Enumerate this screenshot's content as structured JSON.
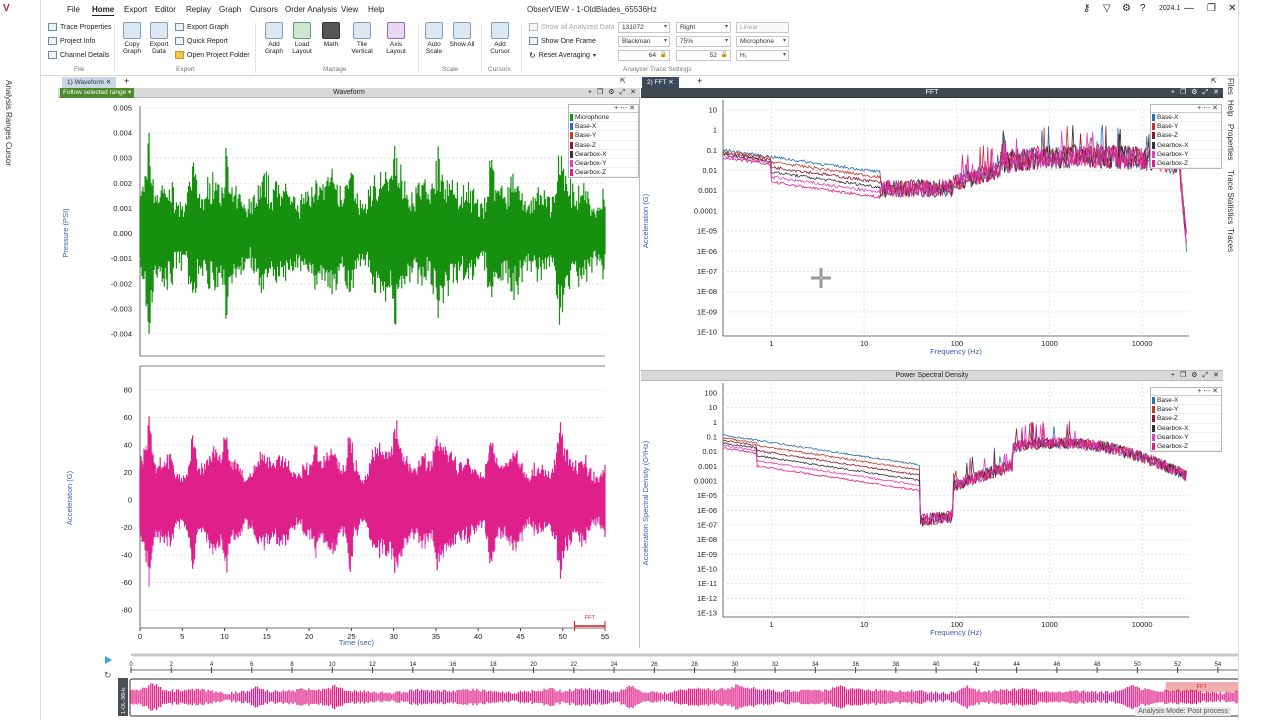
{
  "window": {
    "title": "ObserVIEW - 1-OldBlades_65536Hz",
    "version": "2024.1"
  },
  "menu": [
    "File",
    "Home",
    "Export",
    "Editor",
    "Replay",
    "Graph",
    "Cursors",
    "Order Analysis",
    "View",
    "Help"
  ],
  "menu_active": "Home",
  "ribbon": {
    "file": {
      "items": [
        "Trace Properties",
        "Project Info",
        "Channel Details"
      ],
      "label": "File"
    },
    "export": {
      "big": [
        "Copy Graph",
        "Export Data"
      ],
      "small": [
        "Export Graph",
        "Quick Report",
        "Open Project Folder"
      ],
      "label": "Export"
    },
    "manage": {
      "big": [
        "Add Graph",
        "Load Layout",
        "Math",
        "Tile Vertical",
        "Axis Layout"
      ],
      "label": "Manage"
    },
    "scale": {
      "big": [
        "Auto Scale",
        "Show All"
      ],
      "label": "Scale"
    },
    "cursors": {
      "big": [
        "Add Cursor"
      ],
      "label": "Cursors"
    },
    "analyzer": {
      "label": "Analyzer Trace Settings",
      "checks": [
        "Show all Analyzed Data",
        "Show One Frame",
        "Reset Averaging"
      ],
      "fields": {
        "frame_size": "131072",
        "window": "Blackman",
        "overlap": "75%",
        "averages": "64",
        "frames": "52",
        "align": "Right",
        "reference": "Microphone",
        "scale": "Linear",
        "estimator": "H₁"
      }
    }
  },
  "left_tabs": [
    "Analysis Ranges",
    "Cursor"
  ],
  "right_tabs": [
    "Files",
    "Help",
    "Properties",
    "Trace Statistics",
    "Traces"
  ],
  "doc_tabs": {
    "left": "1) Waveform",
    "right": "2) FFT"
  },
  "waveform": {
    "header": "Waveform",
    "follow_label": "Follow selected range",
    "top_ylabel": "Pressure (PSI)",
    "top_yticks": [
      "0.005",
      "0.004",
      "0.003",
      "0.002",
      "0.001",
      "0.000",
      "-0.001",
      "-0.002",
      "-0.003",
      "-0.004"
    ],
    "bottom_ylabel": "Acceleration (G)",
    "bottom_yticks": [
      "80",
      "60",
      "40",
      "20",
      "0",
      "-20",
      "-40",
      "-60",
      "-80"
    ],
    "xlabel": "Time (sec)",
    "xticks": [
      "0",
      "5",
      "10",
      "15",
      "20",
      "25",
      "30",
      "35",
      "40",
      "45",
      "50",
      "55"
    ],
    "fft_marker": "FFT",
    "colors": {
      "mic": "#16900e",
      "accel": "#e0208a"
    }
  },
  "fft": {
    "header": "FFT",
    "ylabel": "Acceleration (G)",
    "yticks": [
      "10",
      "1",
      "0.1",
      "0.01",
      "0.001",
      "0.0001",
      "1E-05",
      "1E-06",
      "1E-07",
      "1E-08",
      "1E-09",
      "1E-10"
    ],
    "xlabel": "Frequency (Hz)",
    "xticks": [
      "1",
      "10",
      "100",
      "1000",
      "10000"
    ]
  },
  "psd": {
    "header": "Power Spectral Density",
    "ylabel": "Acceleration Spectral Density (G²/Hz)",
    "yticks": [
      "100",
      "10",
      "1",
      "0.1",
      "0.01",
      "0.001",
      "0.0001",
      "1E-05",
      "1E-06",
      "1E-07",
      "1E-08",
      "1E-09",
      "1E-10",
      "1E-11",
      "1E-12",
      "1E-13"
    ],
    "xlabel": "Frequency (Hz)",
    "xticks": [
      "1",
      "10",
      "100",
      "1000",
      "10000"
    ]
  },
  "legend_waveform": [
    {
      "name": "Microphone",
      "color": "#16900e"
    },
    {
      "name": "Base-X",
      "color": "#2a6fb0"
    },
    {
      "name": "Base-Y",
      "color": "#c0392b"
    },
    {
      "name": "Base-Z",
      "color": "#8e1a2e"
    },
    {
      "name": "Gearbox-X",
      "color": "#333333"
    },
    {
      "name": "Gearbox-Y",
      "color": "#e040c0"
    },
    {
      "name": "Gearbox-Z",
      "color": "#e0208a"
    }
  ],
  "legend_spectra": [
    {
      "name": "Base-X",
      "color": "#2a6fb0"
    },
    {
      "name": "Base-Y",
      "color": "#c0392b"
    },
    {
      "name": "Base-Z",
      "color": "#8e1a2e"
    },
    {
      "name": "Gearbox-X",
      "color": "#333333"
    },
    {
      "name": "Gearbox-Y",
      "color": "#e040c0"
    },
    {
      "name": "Gearbox-Z",
      "color": "#e0208a"
    }
  ],
  "timeline": {
    "ticks": [
      "0",
      "2",
      "4",
      "6",
      "8",
      "10",
      "12",
      "14",
      "16",
      "18",
      "20",
      "22",
      "24",
      "26",
      "28",
      "30",
      "32",
      "34",
      "36",
      "38",
      "40",
      "42",
      "44",
      "46",
      "48",
      "50",
      "52",
      "54"
    ],
    "fft_marker": "FFT",
    "file_label": "1-OL-36Hz",
    "status": "Analysis Mode: Post process"
  }
}
